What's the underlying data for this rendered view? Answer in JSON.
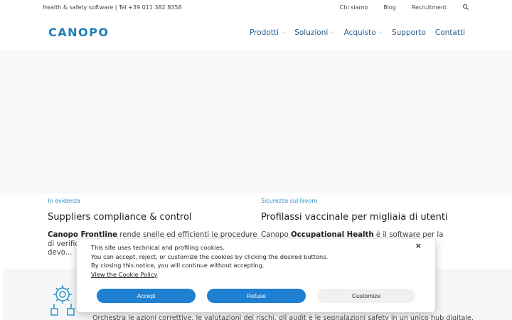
{
  "topbar": {
    "info": "Health & safety software | Tel +39 011 382 8358",
    "links": [
      "Chi siamo",
      "Blog",
      "Recruitment"
    ]
  },
  "header": {
    "logo": "CANOPO",
    "nav": [
      {
        "label": "Prodotti",
        "dropdown": true
      },
      {
        "label": "Soluzioni",
        "dropdown": true
      },
      {
        "label": "Acquisto",
        "dropdown": true
      },
      {
        "label": "Supporto",
        "dropdown": false
      },
      {
        "label": "Contatti",
        "dropdown": false
      }
    ],
    "chevron": "⌵"
  },
  "cards": [
    {
      "tag": "In evidenza",
      "title": "Suppliers compliance & control",
      "text_bold": "Canopo Frontline",
      "text_rest": " rende snelle ed efficienti le procedure di verifica e controllo dei fornitori, riducendo i rischi che devo..."
    },
    {
      "tag": "Sicurezza sul lavoro",
      "title": "Profilassi vaccinale per migliaia di utenti",
      "text_prefix": "Canopo ",
      "text_bold": "Occupational Health",
      "text_rest": " è il software per la gestione ... piani di"
    }
  ],
  "band": {
    "text": "Orchestra le azioni correttive, le valutazioni dei rischi, gli audit e le segnalazioni safety in un unico hub digitale."
  },
  "cookie": {
    "line1": "This site uses technical and profiling cookies.",
    "line2": "You can accept, reject, or customize the cookies by clicking the desired buttons.",
    "line3": "By closing this notice, you will continue without accepting.",
    "policy_link": "View the Cookie Policy",
    "close": "×",
    "accept": "Accept",
    "refuse": "Refuse",
    "customize": "Customize"
  },
  "colors": {
    "brand": "#1f7fb6",
    "button": "#1f7fd0",
    "tag": "#1f8fc8"
  }
}
